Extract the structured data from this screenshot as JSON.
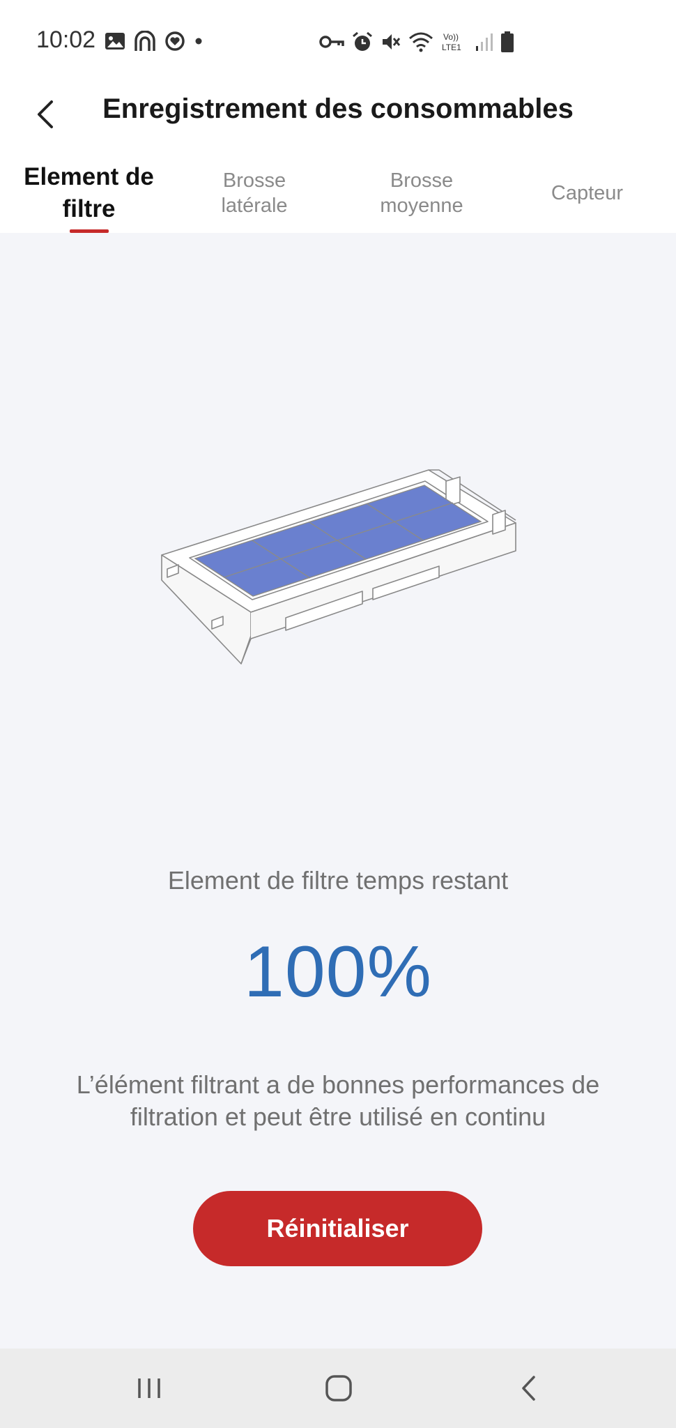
{
  "status_bar": {
    "time": "10:02",
    "left_icons": [
      "gallery-icon",
      "arch-app-icon",
      "heart-app-icon",
      "dot-icon"
    ],
    "right_icons": [
      "vpn-key-icon",
      "alarm-icon",
      "mute-icon",
      "wifi-icon",
      "volte-icon",
      "signal-icon",
      "battery-icon"
    ],
    "volte_text": "Vo)) LTE1"
  },
  "header": {
    "title": "Enregistrement des consommables"
  },
  "tabs": [
    {
      "label": "Element de\nfiltre",
      "active": true
    },
    {
      "label": "Brosse\nlatérale",
      "active": false
    },
    {
      "label": "Brosse\nmoyenne",
      "active": false
    },
    {
      "label": "Capteur",
      "active": false
    }
  ],
  "consumable": {
    "illustration": "filter-element-illustration",
    "remaining_label": "Element de filtre temps restant",
    "remaining_percent": "100%",
    "status_description": "L’élément filtrant a de bonnes performances de filtration et peut être utilisé en continu",
    "reset_label": "Réinitialiser"
  },
  "colors": {
    "accent_red": "#c62a2a",
    "percent_blue": "#2f6db5",
    "filter_blue": "#6a80cf",
    "background": "#f4f5f9"
  },
  "nav_bar": {
    "buttons": [
      "recents-icon",
      "home-icon",
      "back-nav-icon"
    ]
  }
}
